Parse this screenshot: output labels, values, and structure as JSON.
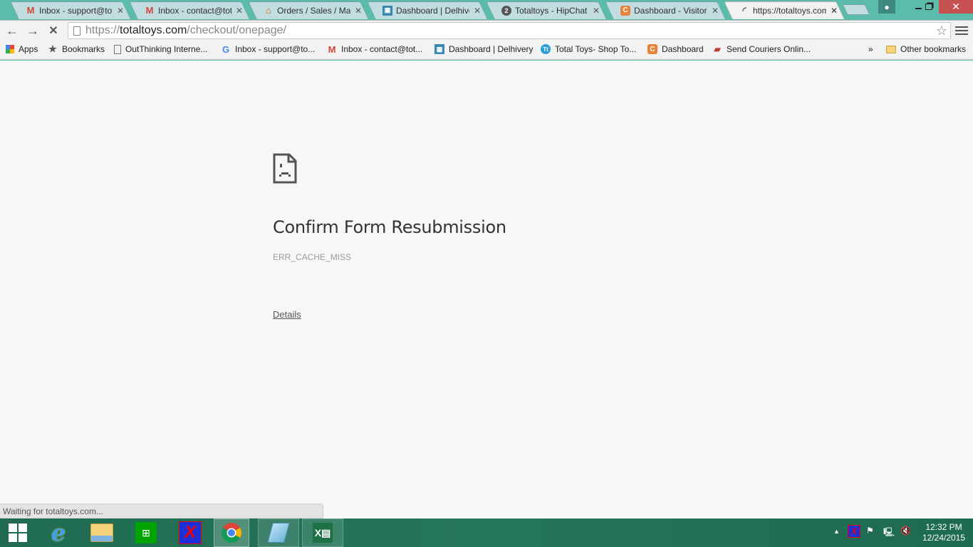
{
  "browser": {
    "tabs": [
      {
        "title": "Inbox - support@tota",
        "icon": "gmail-icon",
        "active": false
      },
      {
        "title": "Inbox - contact@tota",
        "icon": "gmail-icon",
        "active": false
      },
      {
        "title": "Orders / Sales / Mage",
        "icon": "magento-icon",
        "active": false
      },
      {
        "title": "Dashboard | Delhivery",
        "icon": "delhivery-icon",
        "active": false
      },
      {
        "title": "Totaltoys - HipChat",
        "icon": "hipchat-icon",
        "badge": "2",
        "active": false
      },
      {
        "title": "Dashboard - Visitor lis",
        "icon": "dashboard-icon",
        "active": false
      },
      {
        "title": "https://totaltoys.com/",
        "icon": "loading-spinner-icon",
        "active": true
      }
    ],
    "address": {
      "scheme": "https://",
      "host": "totaltoys.com",
      "path": "/checkout/onepage/"
    },
    "bookmarks": [
      {
        "label": "Apps",
        "icon": "apps-grid-icon"
      },
      {
        "label": "Bookmarks",
        "icon": "star-icon"
      },
      {
        "label": "OutThinking Interne...",
        "icon": "page-icon"
      },
      {
        "label": "Inbox - support@to...",
        "icon": "google-icon"
      },
      {
        "label": "Inbox - contact@tot...",
        "icon": "gmail-icon"
      },
      {
        "label": "Dashboard | Delhivery",
        "icon": "delhivery-icon"
      },
      {
        "label": "Total Toys- Shop To...",
        "icon": "totaltoys-icon"
      },
      {
        "label": "Dashboard",
        "icon": "dashboard-icon"
      },
      {
        "label": "Send Couriers Onlin...",
        "icon": "mailbox-icon"
      }
    ],
    "bookmarks_overflow": "»",
    "other_bookmarks": "Other bookmarks",
    "status_text": "Waiting for totaltoys.com..."
  },
  "error_page": {
    "title": "Confirm Form Resubmission",
    "code": "ERR_CACHE_MISS",
    "details_link": "Details"
  },
  "taskbar": {
    "apps": [
      "start",
      "internet-explorer",
      "file-explorer",
      "store",
      "xampp",
      "chrome",
      "notepad",
      "excel"
    ],
    "time": "12:32 PM",
    "date": "12/24/2015"
  },
  "colors": {
    "frame": "#5bbcac",
    "close_button": "#c75050",
    "page_background": "#f7f7f7"
  }
}
